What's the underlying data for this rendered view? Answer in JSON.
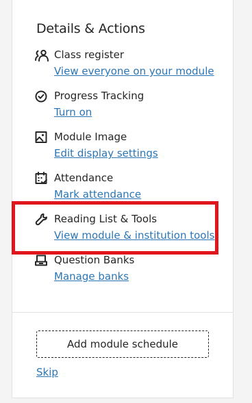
{
  "panel": {
    "heading": "Details & Actions",
    "items": [
      {
        "icon": "class-register-icon",
        "title": "Class register",
        "link": "View everyone on your module"
      },
      {
        "icon": "progress-check-icon",
        "title": "Progress Tracking",
        "link": "Turn on"
      },
      {
        "icon": "image-icon",
        "title": "Module Image",
        "link": "Edit display settings"
      },
      {
        "icon": "calendar-icon",
        "title": "Attendance",
        "link": "Mark attendance"
      },
      {
        "icon": "wrench-icon",
        "title": "Reading List & Tools",
        "link": "View module & institution tools"
      },
      {
        "icon": "question-bank-icon",
        "title": "Question Banks",
        "link": "Manage banks"
      }
    ],
    "add_schedule_label": "Add module schedule",
    "skip_label": "Skip"
  },
  "colors": {
    "link": "#2b76b6",
    "text": "#262626",
    "highlight": "#e0161c"
  }
}
